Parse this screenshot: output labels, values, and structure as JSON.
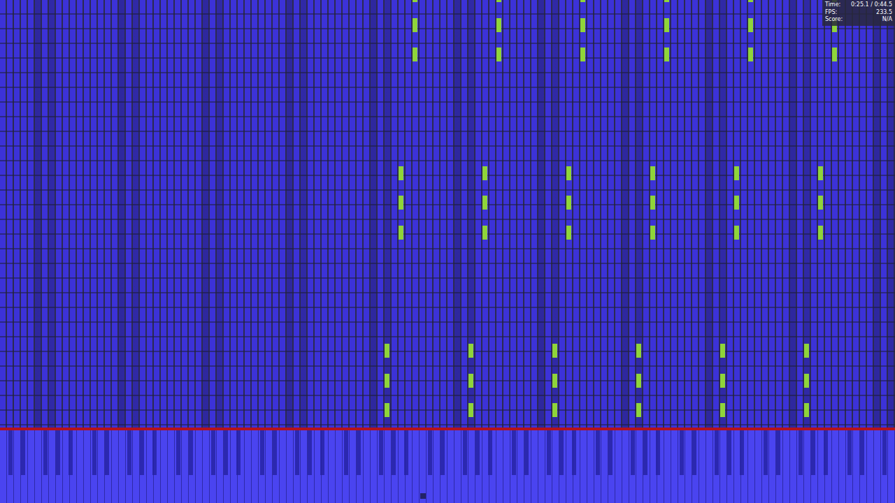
{
  "hud": [
    {
      "label": "Time:",
      "value": "0:25.1 / 0:44.5"
    },
    {
      "label": "FPS:",
      "value": "233.5"
    },
    {
      "label": "Score:",
      "value": "N/A"
    }
  ],
  "highlighted_notes": [
    {
      "key": 59,
      "row": 12
    },
    {
      "key": 71,
      "row": 12
    },
    {
      "key": 83,
      "row": 12
    },
    {
      "key": 95,
      "row": 12
    },
    {
      "key": 107,
      "row": 12
    },
    {
      "key": 119,
      "row": 12
    },
    {
      "key": 59,
      "row": 13
    },
    {
      "key": 71,
      "row": 13
    },
    {
      "key": 83,
      "row": 13
    },
    {
      "key": 95,
      "row": 13
    },
    {
      "key": 107,
      "row": 13
    },
    {
      "key": 119,
      "row": 13
    },
    {
      "key": 59,
      "row": 14
    },
    {
      "key": 71,
      "row": 14
    },
    {
      "key": 83,
      "row": 14
    },
    {
      "key": 95,
      "row": 14
    },
    {
      "key": 107,
      "row": 14
    },
    {
      "key": 119,
      "row": 14
    },
    {
      "key": 57,
      "row": 6
    },
    {
      "key": 69,
      "row": 6
    },
    {
      "key": 81,
      "row": 6
    },
    {
      "key": 93,
      "row": 6
    },
    {
      "key": 105,
      "row": 6
    },
    {
      "key": 117,
      "row": 6
    },
    {
      "key": 57,
      "row": 7
    },
    {
      "key": 69,
      "row": 7
    },
    {
      "key": 81,
      "row": 7
    },
    {
      "key": 93,
      "row": 7
    },
    {
      "key": 105,
      "row": 7
    },
    {
      "key": 117,
      "row": 7
    },
    {
      "key": 57,
      "row": 8
    },
    {
      "key": 69,
      "row": 8
    },
    {
      "key": 81,
      "row": 8
    },
    {
      "key": 93,
      "row": 8
    },
    {
      "key": 105,
      "row": 8
    },
    {
      "key": 117,
      "row": 8
    },
    {
      "key": 55,
      "row": 0
    },
    {
      "key": 67,
      "row": 0
    },
    {
      "key": 79,
      "row": 0
    },
    {
      "key": 91,
      "row": 0
    },
    {
      "key": 103,
      "row": 0
    },
    {
      "key": 115,
      "row": 0
    },
    {
      "key": 55,
      "row": 1
    },
    {
      "key": 67,
      "row": 1
    },
    {
      "key": 79,
      "row": 1
    },
    {
      "key": 91,
      "row": 1
    },
    {
      "key": 103,
      "row": 1
    },
    {
      "key": 115,
      "row": 1
    },
    {
      "key": 55,
      "row": 2
    },
    {
      "key": 67,
      "row": 2
    },
    {
      "key": 79,
      "row": 2
    },
    {
      "key": 91,
      "row": 2
    },
    {
      "key": 103,
      "row": 2
    },
    {
      "key": 115,
      "row": 2
    }
  ]
}
